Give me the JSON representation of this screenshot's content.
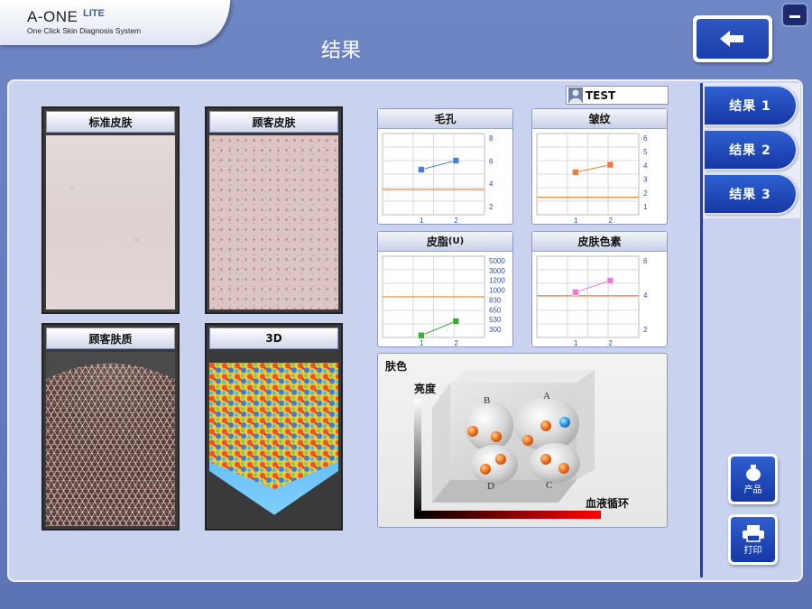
{
  "header": {
    "logo_main": "A-ONE",
    "logo_lite": "LITE",
    "logo_sub": "One Click Skin Diagnosis System",
    "title": "结果"
  },
  "user": {
    "name": "TEST"
  },
  "images": {
    "standard_skin": "标准皮肤",
    "customer_skin": "顾客皮肤",
    "customer_texture": "顾客肤质",
    "three_d": "3D"
  },
  "graphs": {
    "pores": {
      "title": "毛孔",
      "y_ticks": [
        "8",
        "6",
        "4",
        "2"
      ],
      "x_ticks": [
        "1",
        "2"
      ],
      "values": [
        5.0,
        6.0
      ],
      "reference": 2.8,
      "ylim": [
        0,
        9
      ],
      "color": "#4a7fd6"
    },
    "wrinkles": {
      "title": "皱纹",
      "y_ticks": [
        "6",
        "5",
        "4",
        "3",
        "2",
        "1"
      ],
      "x_ticks": [
        "1",
        "2"
      ],
      "values": [
        3.4,
        4.0
      ],
      "reference": 1.4,
      "ylim": [
        0,
        6.5
      ],
      "color": "#f07a3a"
    },
    "sebum": {
      "title": "皮脂",
      "unit": "(U)",
      "y_ticks": [
        "5000",
        "3000",
        "1200",
        "1000",
        "830",
        "650",
        "530",
        "300"
      ],
      "x_ticks": [
        "1",
        "2"
      ],
      "values": [
        0.2,
        1.6
      ],
      "reference": 4.0,
      "ylim": [
        0,
        8
      ],
      "color": "#3aaa3a"
    },
    "pigment": {
      "title": "皮肤色素",
      "y_ticks": [
        "6",
        "4",
        "2"
      ],
      "x_ticks": [
        "1",
        "2"
      ],
      "values": [
        3.9,
        4.9
      ],
      "reference": 3.6,
      "ylim": [
        0,
        7
      ],
      "color": "#f07ad6"
    }
  },
  "skin_color": {
    "title": "肤色",
    "brightness_label": "亮度",
    "blood_label": "血液循环",
    "groups": [
      "A",
      "B",
      "C",
      "D"
    ]
  },
  "tabs": [
    "结果 1",
    "结果 2",
    "结果 3"
  ],
  "side_buttons": {
    "products": "产品",
    "print": "打印"
  },
  "colors": {
    "accent": "#1a3ea8",
    "orange_line": "#f08a3a"
  }
}
